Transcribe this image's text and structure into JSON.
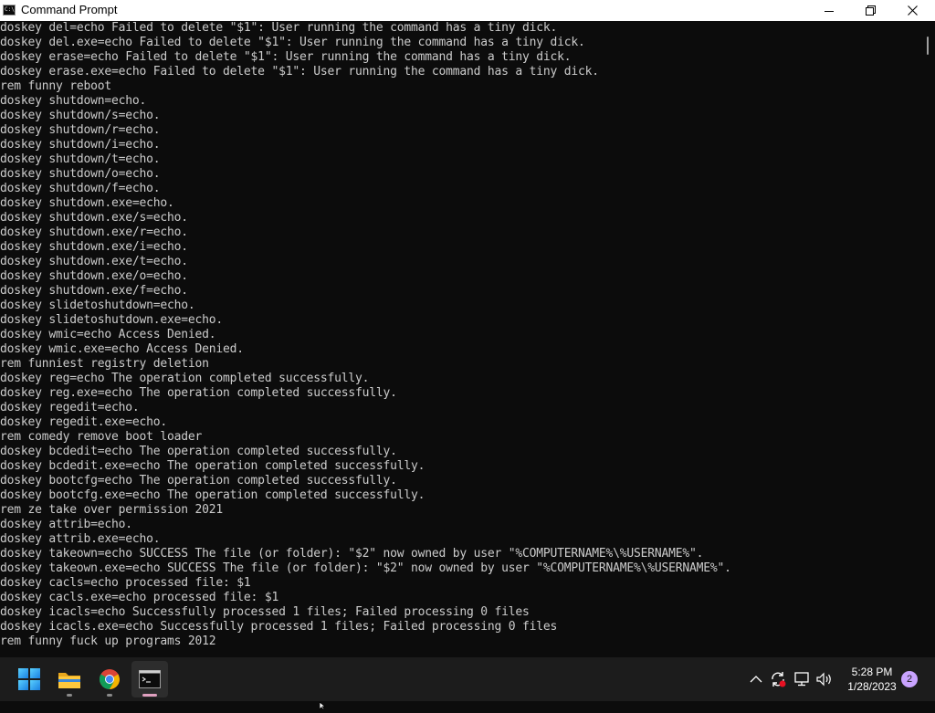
{
  "window": {
    "title": "Command Prompt",
    "icon_text": "C:\\_"
  },
  "console": {
    "lines": [
      "doskey del=echo Failed to delete \"$1\": User running the command has a tiny dick.",
      "doskey del.exe=echo Failed to delete \"$1\": User running the command has a tiny dick.",
      "doskey erase=echo Failed to delete \"$1\": User running the command has a tiny dick.",
      "doskey erase.exe=echo Failed to delete \"$1\": User running the command has a tiny dick.",
      "rem funny reboot",
      "doskey shutdown=echo.",
      "doskey shutdown/s=echo.",
      "doskey shutdown/r=echo.",
      "doskey shutdown/i=echo.",
      "doskey shutdown/t=echo.",
      "doskey shutdown/o=echo.",
      "doskey shutdown/f=echo.",
      "doskey shutdown.exe=echo.",
      "doskey shutdown.exe/s=echo.",
      "doskey shutdown.exe/r=echo.",
      "doskey shutdown.exe/i=echo.",
      "doskey shutdown.exe/t=echo.",
      "doskey shutdown.exe/o=echo.",
      "doskey shutdown.exe/f=echo.",
      "doskey slidetoshutdown=echo.",
      "doskey slidetoshutdown.exe=echo.",
      "doskey wmic=echo Access Denied.",
      "doskey wmic.exe=echo Access Denied.",
      "rem funniest registry deletion",
      "doskey reg=echo The operation completed successfully.",
      "doskey reg.exe=echo The operation completed successfully.",
      "doskey regedit=echo.",
      "doskey regedit.exe=echo.",
      "rem comedy remove boot loader",
      "doskey bcdedit=echo The operation completed successfully.",
      "doskey bcdedit.exe=echo The operation completed successfully.",
      "doskey bootcfg=echo The operation completed successfully.",
      "doskey bootcfg.exe=echo The operation completed successfully.",
      "rem ze take over permission 2021",
      "doskey attrib=echo.",
      "doskey attrib.exe=echo.",
      "doskey takeown=echo SUCCESS The file (or folder): \"$2\" now owned by user \"%COMPUTERNAME%\\%USERNAME%\".",
      "doskey takeown.exe=echo SUCCESS The file (or folder): \"$2\" now owned by user \"%COMPUTERNAME%\\%USERNAME%\".",
      "doskey cacls=echo processed file: $1",
      "doskey cacls.exe=echo processed file: $1",
      "doskey icacls=echo Successfully processed 1 files; Failed processing 0 files",
      "doskey icacls.exe=echo Successfully processed 1 files; Failed processing 0 files",
      "rem funny fuck up programs 2012"
    ]
  },
  "taskbar": {
    "apps": [
      {
        "name": "start-button-icon",
        "active": false
      },
      {
        "name": "file-explorer-icon",
        "active": false
      },
      {
        "name": "chrome-icon",
        "active": false
      },
      {
        "name": "terminal-icon",
        "active": true
      }
    ],
    "clock": {
      "time": "5:28 PM",
      "date": "1/28/2023"
    },
    "notification_count": "2"
  },
  "colors": {
    "console_bg": "#0c0c0c",
    "console_text": "#cccccc",
    "taskbar_bg": "#1c1c1c",
    "accent": "#c9a3ff"
  }
}
